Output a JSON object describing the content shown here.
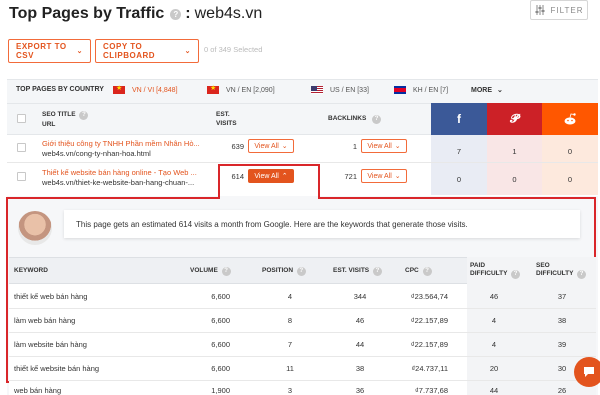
{
  "header": {
    "title": "Top Pages by Traffic",
    "colon": ":",
    "domain": "web4s.vn",
    "filter_label": "FILTER"
  },
  "toolbar": {
    "export_label": "EXPORT TO CSV",
    "clipboard_label": "COPY TO CLIPBOARD",
    "selection_text": "0 of 349 Selected"
  },
  "country_bar": {
    "label": "TOP PAGES BY COUNTRY",
    "countries": [
      {
        "text": "VN / VI  [4,848]",
        "flag": "vn",
        "active": true
      },
      {
        "text": "VN / EN  [2,090]",
        "flag": "vn",
        "active": false
      },
      {
        "text": "US / EN  [33]",
        "flag": "us",
        "active": false
      },
      {
        "text": "KH / EN  [7]",
        "flag": "kh",
        "active": false
      }
    ],
    "more_label": "MORE"
  },
  "table": {
    "headers": {
      "seo_title": "SEO TITLE",
      "url": "URL",
      "est": "EST.",
      "visits": "VISITS",
      "backlinks": "BACKLINKS"
    },
    "rows": [
      {
        "title": "Giới thiệu công ty TNHH Phần mềm Nhân Hò...",
        "url": "web4s.vn/cong-ty-nhan-hoa.html",
        "visits": "639",
        "backlinks": "1",
        "facebook": "7",
        "pinterest": "1",
        "reddit": "0"
      },
      {
        "title": "Thiết kế website bán hàng online - Tạo Web ...",
        "url": "web4s.vn/thiet-ke-website-ban-hang-chuan-...",
        "visits": "614",
        "backlinks": "721",
        "facebook": "0",
        "pinterest": "0",
        "reddit": "0"
      }
    ],
    "view_all_label": "View All"
  },
  "panel": {
    "message": "This page gets an estimated 614 visits a month from Google. Here are the keywords that generate those visits.",
    "headers": {
      "keyword": "KEYWORD",
      "volume": "VOLUME",
      "position": "POSITION",
      "est_visits": "EST. VISITS",
      "cpc": "CPC",
      "paid": "PAID",
      "paid2": "DIFFICULTY",
      "seo": "SEO",
      "seo2": "DIFFICULTY"
    },
    "keywords": [
      {
        "keyword": "thiết kế web bán hàng",
        "volume": "6,600",
        "position": "4",
        "visits": "344",
        "cpc": "₫23.564,74",
        "paid": "46",
        "seo": "37"
      },
      {
        "keyword": "làm web bán hàng",
        "volume": "6,600",
        "position": "8",
        "visits": "46",
        "cpc": "₫22.157,89",
        "paid": "4",
        "seo": "38"
      },
      {
        "keyword": "làm website bán hàng",
        "volume": "6,600",
        "position": "7",
        "visits": "44",
        "cpc": "₫22.157,89",
        "paid": "4",
        "seo": "39"
      },
      {
        "keyword": "thiết kế website bán hàng",
        "volume": "6,600",
        "position": "11",
        "visits": "38",
        "cpc": "₫24.737,11",
        "paid": "20",
        "seo": "30"
      },
      {
        "keyword": "web bán hàng",
        "volume": "1,900",
        "position": "3",
        "visits": "36",
        "cpc": "₫7.737,68",
        "paid": "44",
        "seo": "26"
      }
    ]
  },
  "colors": {
    "accent": "#e3541e",
    "facebook": "#3b5998",
    "pinterest": "#cc2127",
    "reddit": "#ff5700",
    "highlight_border": "#d9262a"
  }
}
